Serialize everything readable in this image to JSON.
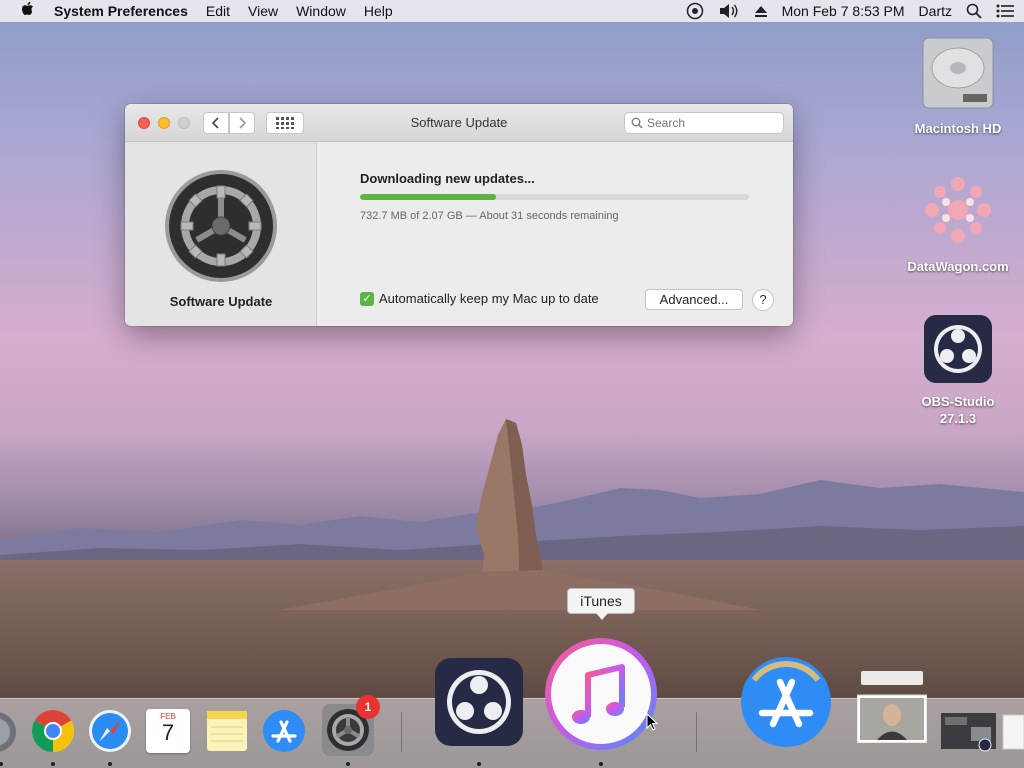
{
  "menubar": {
    "app_name": "System Preferences",
    "items": [
      "Edit",
      "View",
      "Window",
      "Help"
    ],
    "datetime": "Mon Feb 7  8:53 PM",
    "user": "Dartz"
  },
  "desktop_icons": [
    {
      "label": "Macintosh HD",
      "icon": "hard-drive-icon"
    },
    {
      "label": "DataWagon.com",
      "icon": "datawagon-icon"
    },
    {
      "label": "OBS-Studio 27.1.3",
      "icon": "obs-icon"
    }
  ],
  "window": {
    "title": "Software Update",
    "search_placeholder": "Search",
    "pane_label": "Software Update",
    "download_heading": "Downloading new updates...",
    "progress": 0.35,
    "status": "732.7 MB of 2.07 GB — About 31 seconds remaining",
    "auto_update_label": "Automatically keep my Mac up to date",
    "auto_update_checked": true,
    "advanced_label": "Advanced...",
    "help_label": "?"
  },
  "tooltip": "iTunes",
  "dock": {
    "items": [
      {
        "name": "partial-app",
        "running": true
      },
      {
        "name": "chrome",
        "running": true
      },
      {
        "name": "safari",
        "running": true
      },
      {
        "name": "calendar",
        "running": false,
        "month": "FEB",
        "day": "7"
      },
      {
        "name": "notes",
        "running": false
      },
      {
        "name": "app-store",
        "running": false
      },
      {
        "name": "system-preferences",
        "running": true,
        "badge": "1"
      },
      {
        "name": "obs",
        "running": true
      },
      {
        "name": "itunes",
        "running": true
      },
      {
        "name": "app-store-large",
        "running": false
      },
      {
        "name": "webcam-preview",
        "running": false
      },
      {
        "name": "screenshot-preview",
        "running": false
      }
    ]
  },
  "colors": {
    "progress": "#5bb443",
    "close": "#fc5f57",
    "minimize": "#fdbc2e",
    "badge": "#e8332e"
  }
}
